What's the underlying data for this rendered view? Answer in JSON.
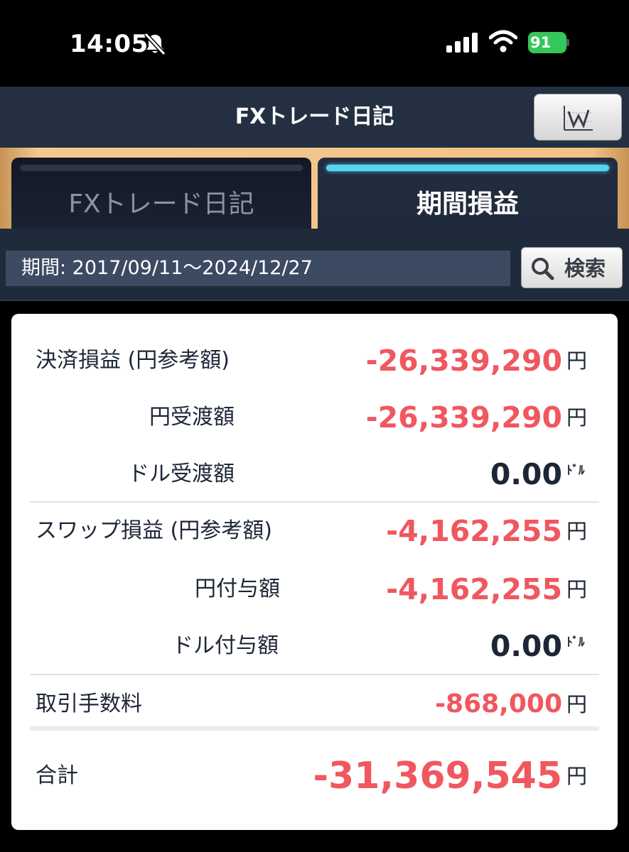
{
  "status_bar": {
    "time": "14:05",
    "battery": "91"
  },
  "header": {
    "title": "FXトレード日記"
  },
  "tabs": [
    {
      "label": "FXトレード日記",
      "active": false
    },
    {
      "label": "期間損益",
      "active": true
    }
  ],
  "search": {
    "period_text": "期間: 2017/09/11〜2024/12/27",
    "button_label": "検索"
  },
  "results": {
    "settlement_pl": {
      "label": "決済損益 (円参考額)",
      "value": "-26,339,290",
      "unit": "円"
    },
    "yen_delivery": {
      "label": "円受渡額",
      "value": "-26,339,290",
      "unit": "円"
    },
    "dollar_delivery": {
      "label": "ドル受渡額",
      "value": "0.00",
      "unit": "ﾄﾞﾙ"
    },
    "swap_pl": {
      "label": "スワップ損益 (円参考額)",
      "value": "-4,162,255",
      "unit": "円"
    },
    "yen_granted": {
      "label": "円付与額",
      "value": "-4,162,255",
      "unit": "円"
    },
    "dollar_granted": {
      "label": "ドル付与額",
      "value": "0.00",
      "unit": "ﾄﾞﾙ"
    },
    "fees": {
      "label": "取引手数料",
      "value": "-868,000",
      "unit": "円"
    },
    "total": {
      "label": "合計",
      "value": "-31,369,545",
      "unit": "円"
    }
  },
  "colors": {
    "negative": "#f0575e",
    "header_bg": "#243042",
    "active_tab_indicator": "#56d2f2",
    "tab_frame": "#f1c386"
  }
}
